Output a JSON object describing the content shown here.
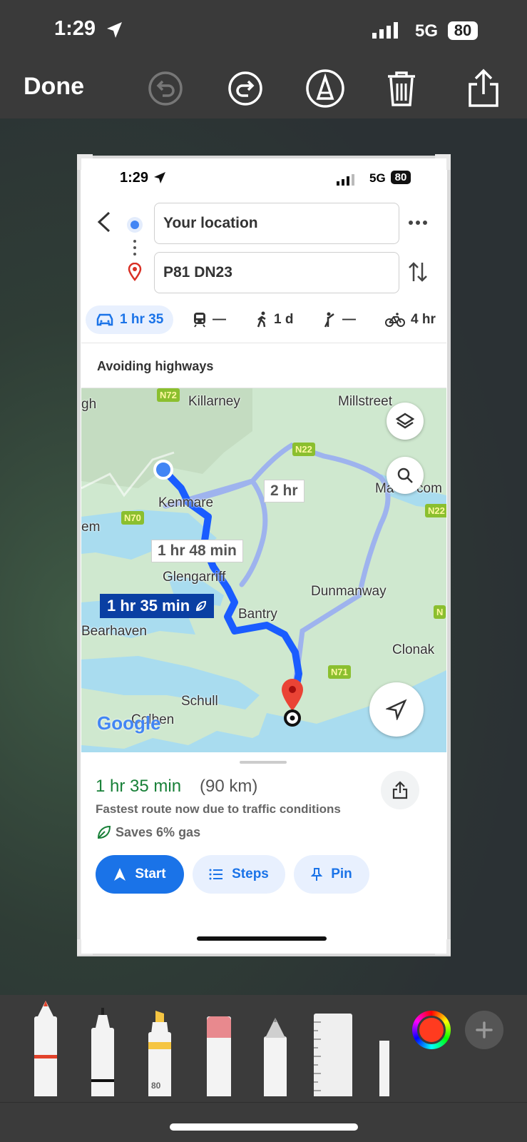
{
  "outer_status": {
    "time": "1:29",
    "network": "5G",
    "battery": "80"
  },
  "markup_toolbar": {
    "done_label": "Done"
  },
  "inner_status": {
    "time": "1:29",
    "network": "5G",
    "battery": "80"
  },
  "directions": {
    "origin": "Your location",
    "destination": "P81 DN23",
    "modes": [
      {
        "icon": "car-icon",
        "label": "1 hr 35"
      },
      {
        "icon": "train-icon",
        "label": "—"
      },
      {
        "icon": "walk-icon",
        "label": "1 d"
      },
      {
        "icon": "rideshare-icon",
        "label": "—"
      },
      {
        "icon": "bike-icon",
        "label": "4 hr"
      }
    ],
    "avoid_note": "Avoiding highways"
  },
  "map": {
    "places": [
      "Killarney",
      "Millstreet",
      "Kenmare",
      "Glengarriff",
      "Bantry",
      "Bearhaven",
      "Dunmanway",
      "Clonak",
      "Schull",
      "Colben",
      "gh",
      "em",
      "Ma",
      "com"
    ],
    "roads": [
      "N72",
      "N22",
      "N70",
      "N22",
      "N71",
      "N"
    ],
    "route_labels": {
      "alt1": "2 hr",
      "alt2": "1 hr 48 min",
      "main": "1 hr 35 min"
    },
    "brand": "Google"
  },
  "route_sheet": {
    "duration": "1 hr 35 min",
    "distance": "(90 km)",
    "note": "Fastest route now due to traffic conditions",
    "savings": "Saves 6% gas",
    "start_label": "Start",
    "steps_label": "Steps",
    "pin_label": "Pin"
  },
  "tools": {
    "marker_number": "80"
  },
  "colors": {
    "accent": "#1a73e8",
    "route": "#1a5cff",
    "green": "#188038"
  }
}
